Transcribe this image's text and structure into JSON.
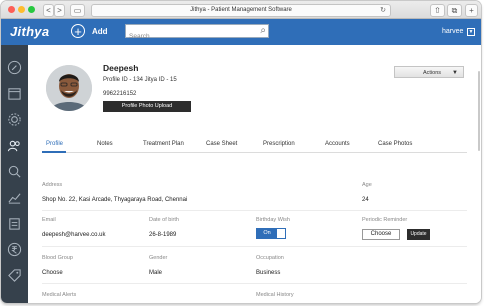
{
  "browser": {
    "title": "Jithya - Patient Management Software",
    "back": "<",
    "forward": ">",
    "reload": "C"
  },
  "app": {
    "logo": "Jithya",
    "add_label": "Add",
    "search_placeholder": "Search",
    "user": "harvee",
    "accent": "#2f6eb8"
  },
  "sidebar": {
    "items": [
      {
        "icon": "edit-icon"
      },
      {
        "icon": "calendar-icon"
      },
      {
        "icon": "gear-icon"
      },
      {
        "icon": "users-icon"
      },
      {
        "icon": "search-icon"
      },
      {
        "icon": "chart-icon"
      },
      {
        "icon": "clipboard-icon"
      },
      {
        "icon": "rupee-icon"
      },
      {
        "icon": "tag-icon"
      }
    ]
  },
  "profile": {
    "name": "Deepesh",
    "ids": "Profile ID - 134  Jitya ID - 15",
    "phone": "9962216152",
    "upload_button": "Profile Photo Upload",
    "actions_button": "Actions"
  },
  "tabs": [
    "Profile",
    "Notes",
    "Treatment Plan",
    "Case Sheet",
    "Prescription",
    "Accounts",
    "Case Photos"
  ],
  "fields": {
    "address_label": "Address",
    "address_value": "Shop No. 22, Kasi Arcade, Thyagaraya Road, Chennai",
    "age_label": "Age",
    "age_value": "24",
    "email_label": "Email",
    "email_value": "deepesh@harvee.co.uk",
    "dob_label": "Date of birth",
    "dob_value": "26-8-1989",
    "bday_label": "Birthday Wish",
    "bday_toggle": "On",
    "reminder_label": "Periodic Reminder",
    "choose_label": "Choose",
    "update_label": "Update",
    "blood_label": "Blood Group",
    "blood_value": "Choose",
    "gender_label": "Gender",
    "gender_value": "Male",
    "occupation_label": "Occupation",
    "occupation_value": "Business",
    "alerts_label": "Medical Alerts",
    "history_label": "Medical History"
  }
}
